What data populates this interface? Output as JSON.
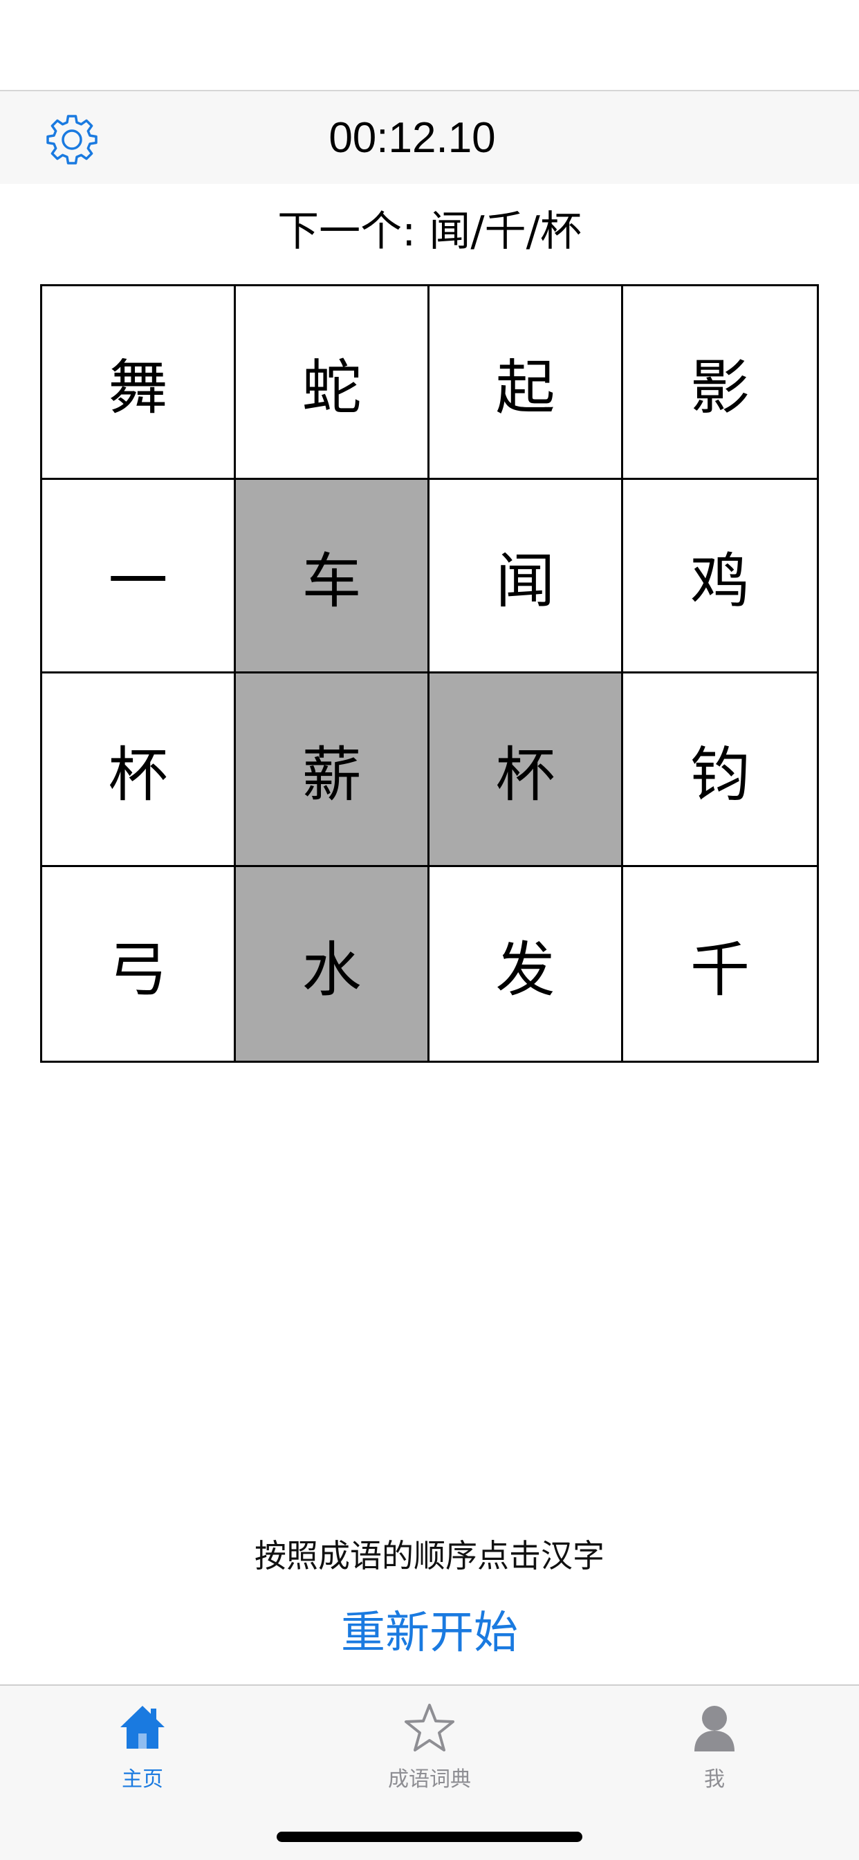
{
  "header": {
    "timer": "00:12.10",
    "settings_icon": "gear-icon",
    "accent_color": "#1a7ae0"
  },
  "next_prompt": {
    "text": "下一个: 闻/千/杯"
  },
  "grid": {
    "rows": 4,
    "columns": 4,
    "selected_color": "#aaaaaa",
    "cells": [
      {
        "char": "舞",
        "selected": false
      },
      {
        "char": "蛇",
        "selected": false
      },
      {
        "char": "起",
        "selected": false
      },
      {
        "char": "影",
        "selected": false
      },
      {
        "char": "一",
        "selected": false
      },
      {
        "char": "车",
        "selected": true
      },
      {
        "char": "闻",
        "selected": false
      },
      {
        "char": "鸡",
        "selected": false
      },
      {
        "char": "杯",
        "selected": false
      },
      {
        "char": "薪",
        "selected": true
      },
      {
        "char": "杯",
        "selected": true
      },
      {
        "char": "钧",
        "selected": false
      },
      {
        "char": "弓",
        "selected": false
      },
      {
        "char": "水",
        "selected": true
      },
      {
        "char": "发",
        "selected": false
      },
      {
        "char": "千",
        "selected": false
      }
    ]
  },
  "footer": {
    "hint": "按照成语的顺序点击汉字",
    "restart_label": "重新开始"
  },
  "tab_bar": {
    "tabs": [
      {
        "label": "主页",
        "icon": "home-icon",
        "active": true
      },
      {
        "label": "成语词典",
        "icon": "star-icon",
        "active": false
      },
      {
        "label": "我",
        "icon": "person-icon",
        "active": false
      }
    ]
  }
}
